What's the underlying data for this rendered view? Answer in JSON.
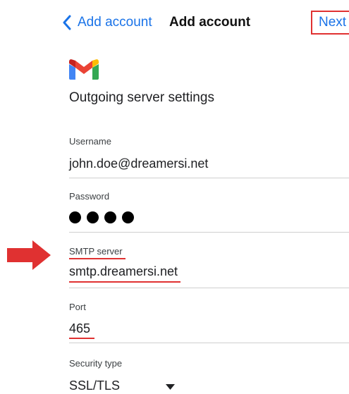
{
  "nav": {
    "back_label": "Add account",
    "title": "Add account",
    "next_label": "Next"
  },
  "screen": {
    "title": "Outgoing server settings"
  },
  "fields": {
    "username": {
      "label": "Username",
      "value": "john.doe@dreamersi.net"
    },
    "password": {
      "label": "Password",
      "masked_length": 4
    },
    "smtp_server": {
      "label": "SMTP server",
      "value": "smtp.dreamersi.net"
    },
    "port": {
      "label": "Port",
      "value": "465"
    },
    "security_type": {
      "label": "Security type",
      "value": "SSL/TLS"
    }
  },
  "colors": {
    "accent": "#1a73e8",
    "annotation": "#e03131"
  },
  "icons": {
    "back": "chevron-left-icon",
    "logo": "gmail-logo-icon",
    "annotation_arrow": "red-arrow-icon",
    "dropdown": "caret-down-icon"
  }
}
